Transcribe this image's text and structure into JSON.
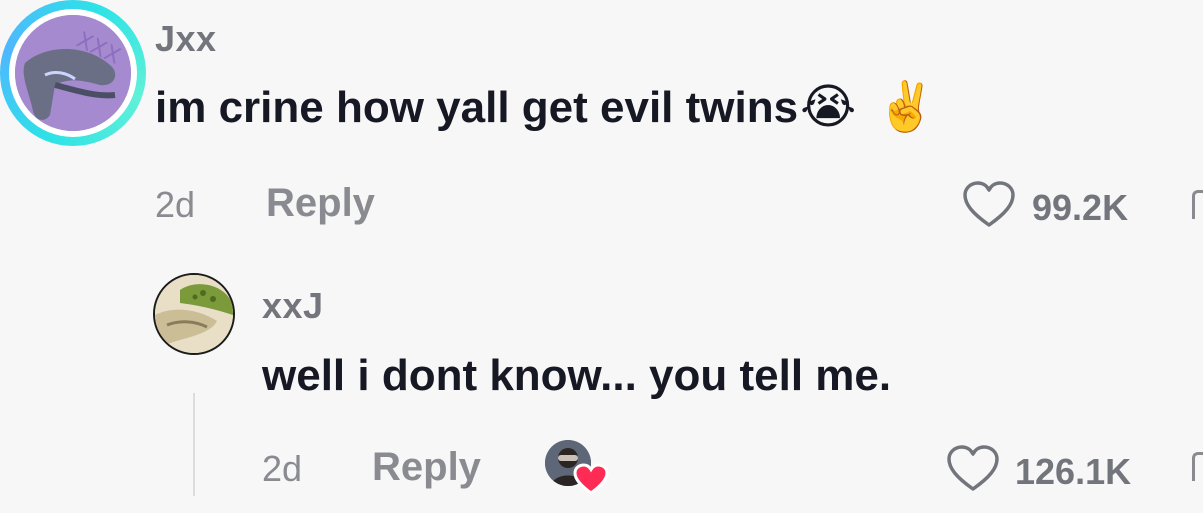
{
  "comment": {
    "username": "Jxx",
    "text": "im crine how yall get evil twins",
    "emojis": [
      "😭",
      "✌️"
    ],
    "age": "2d",
    "reply_label": "Reply",
    "likes": "99.2K",
    "avatar_ring_colors": [
      "#2de2e6",
      "#4fb7ff"
    ]
  },
  "reply": {
    "username": "xxJ",
    "text": "well i dont know... you tell me.",
    "age": "2d",
    "reply_label": "Reply",
    "likes": "126.1K",
    "creator_liked": true,
    "heart_color": "#fe2c55"
  }
}
